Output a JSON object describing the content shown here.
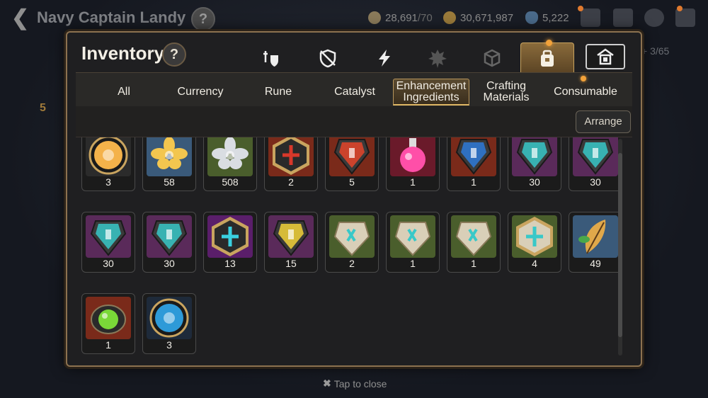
{
  "background": {
    "title": "Navy Captain Landy",
    "resources": {
      "stamina_value": "28,691",
      "stamina_max": "/70",
      "gold": "30,671,987",
      "skystones": "5,222"
    },
    "side_count": "+ 3/65",
    "side_badge": "5"
  },
  "panel": {
    "title": "Inventory",
    "help_label": "?",
    "icon_tabs": [
      {
        "name": "weapon-armor-icon"
      },
      {
        "name": "accessory-shield-icon"
      },
      {
        "name": "artifact-bolt-icon"
      },
      {
        "name": "gem-spike-icon"
      },
      {
        "name": "cube-material-icon"
      },
      {
        "name": "bag-material-icon",
        "active": true
      },
      {
        "name": "storehouse-icon"
      }
    ],
    "categories": [
      {
        "label": "All"
      },
      {
        "label": "Currency"
      },
      {
        "label": "Rune"
      },
      {
        "label": "Catalyst"
      },
      {
        "label": "Enhancement\nIngredients",
        "line1": "Enhancement",
        "line2": "Ingredients",
        "active": true
      },
      {
        "label": "Crafting\nMaterials",
        "line1": "Crafting",
        "line2": "Materials"
      },
      {
        "label": "Consumable"
      }
    ],
    "arrange_label": "Arrange",
    "close_hint": "Tap to close"
  },
  "items": [
    {
      "name": "item-chibi-penguin",
      "count": "3",
      "bg": "#2b2b2b",
      "shape": "circle",
      "color": "#f4b24a"
    },
    {
      "name": "item-gold-flower",
      "count": "58",
      "bg": "#3a5a7a",
      "shape": "flower",
      "color": "#f3c64f"
    },
    {
      "name": "item-silver-flower",
      "count": "508",
      "bg": "#4a5e2c",
      "shape": "flower",
      "color": "#d9dde2"
    },
    {
      "name": "item-red-catalyst",
      "count": "2",
      "bg": "#7a2a1a",
      "shape": "hexgem",
      "color": "#d8382a"
    },
    {
      "name": "item-red-rune-hammer",
      "count": "5",
      "bg": "#7a2a1a",
      "shape": "gem",
      "color": "#e5452a"
    },
    {
      "name": "item-pink-potion",
      "count": "1",
      "bg": "#6a1a2a",
      "shape": "flask",
      "color": "#ff4fa8"
    },
    {
      "name": "item-blue-rune",
      "count": "1",
      "bg": "#7a2a1a",
      "shape": "gem",
      "color": "#2e7ad8"
    },
    {
      "name": "item-teal-rune-sword",
      "count": "30",
      "bg": "#5a2a5a",
      "shape": "gem",
      "color": "#38c8c8"
    },
    {
      "name": "item-teal-rune-spiral",
      "count": "30",
      "bg": "#5a2a5a",
      "shape": "gem",
      "color": "#38c8c8"
    },
    {
      "name": "item-teal-rune-shield",
      "count": "30",
      "bg": "#5a2a5a",
      "shape": "gem",
      "color": "#38c8c8"
    },
    {
      "name": "item-teal-rune-boot",
      "count": "30",
      "bg": "#5a2a5a",
      "shape": "gem",
      "color": "#38c8c8"
    },
    {
      "name": "item-purple-rune-cross",
      "count": "13",
      "bg": "#5a1e6a",
      "shape": "hexgem",
      "color": "#3ad0e0"
    },
    {
      "name": "item-purple-rune-hammer",
      "count": "15",
      "bg": "#5a2a5a",
      "shape": "gem",
      "color": "#f2d23a"
    },
    {
      "name": "item-stone-rune-sword",
      "count": "2",
      "bg": "#4a5e2c",
      "shape": "stone",
      "color": "#38c8c8"
    },
    {
      "name": "item-stone-rune-spiral",
      "count": "1",
      "bg": "#4a5e2c",
      "shape": "stone",
      "color": "#38c8c8"
    },
    {
      "name": "item-stone-rune-shield",
      "count": "1",
      "bg": "#4a5e2c",
      "shape": "stone",
      "color": "#38c8c8"
    },
    {
      "name": "item-stone-rune-star",
      "count": "4",
      "bg": "#4a5e2c",
      "shape": "hexstone",
      "color": "#38c8c8"
    },
    {
      "name": "item-feather-herb",
      "count": "49",
      "bg": "#3a5a7a",
      "shape": "feather",
      "color": "#e0a84a"
    },
    {
      "name": "item-green-slime-gem",
      "count": "1",
      "bg": "#7a2a1a",
      "shape": "orb",
      "color": "#7ad838"
    },
    {
      "name": "item-blue-rune-orb",
      "count": "3",
      "bg": "#1e2a3a",
      "shape": "circle",
      "color": "#2e9ad8"
    }
  ]
}
